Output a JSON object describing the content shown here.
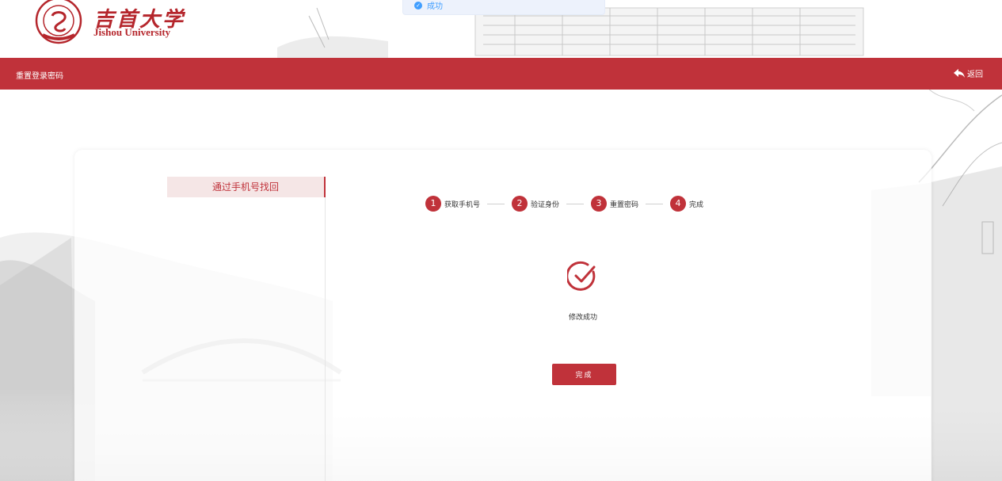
{
  "header": {
    "logo_cn": "吉首大学",
    "logo_en": "Jishou University"
  },
  "toast": {
    "text": "成功"
  },
  "navbar": {
    "title": "重置登录密码",
    "back_label": "返回"
  },
  "sidebar": {
    "tab_label": "通过手机号找回"
  },
  "steps": [
    {
      "num": "1",
      "label": "获取手机号"
    },
    {
      "num": "2",
      "label": "验证身份"
    },
    {
      "num": "3",
      "label": "重置密码"
    },
    {
      "num": "4",
      "label": "完成"
    }
  ],
  "result": {
    "message": "修改成功",
    "done_label": "完成"
  },
  "colors": {
    "brand": "#c0323a",
    "toast": "#409eff"
  },
  "icons": [
    "seal-logo-icon",
    "check-circle-icon",
    "back-arrow-icon",
    "check-small-icon"
  ]
}
